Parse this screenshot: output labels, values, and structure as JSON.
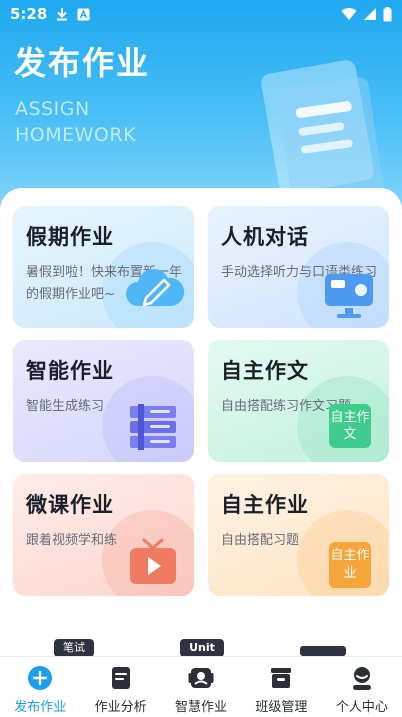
{
  "status_bar": {
    "time": "5:28"
  },
  "hero": {
    "title": "发布作业",
    "subtitle_line1": "ASSIGN",
    "subtitle_line2": "HOMEWORK"
  },
  "cards": [
    {
      "title": "假期作业",
      "desc": "暑假到啦！快来布置新一年的假期作业吧~",
      "color": "#dff2ff"
    },
    {
      "title": "人机对话",
      "desc": "手动选择听力与口语类练习",
      "color": "#e1eeff"
    },
    {
      "title": "智能作业",
      "desc": "智能生成练习",
      "color": "#e3e4ff"
    },
    {
      "title": "自主作文",
      "desc": "自由搭配练习作文习题",
      "color": "#ddf8ee",
      "icon_text": "自主作文"
    },
    {
      "title": "微课作业",
      "desc": "跟着视频学和练",
      "color": "#ffe6e2"
    },
    {
      "title": "自主作业",
      "desc": "自由搭配习题",
      "color": "#fff0de",
      "icon_text": "自主作业"
    }
  ],
  "peek": {
    "label1": "笔试",
    "label2": "Unit"
  },
  "tabbar": {
    "active": "发布作业",
    "items": [
      {
        "label": "发布作业",
        "icon": "plus-circle-icon"
      },
      {
        "label": "作业分析",
        "icon": "document-icon"
      },
      {
        "label": "智慧作业",
        "icon": "smart-book-icon"
      },
      {
        "label": "班级管理",
        "icon": "class-box-icon"
      },
      {
        "label": "个人中心",
        "icon": "person-icon"
      }
    ]
  },
  "colors": {
    "accent": "#1aa0ee",
    "hero_top": "#1ea8f0"
  }
}
